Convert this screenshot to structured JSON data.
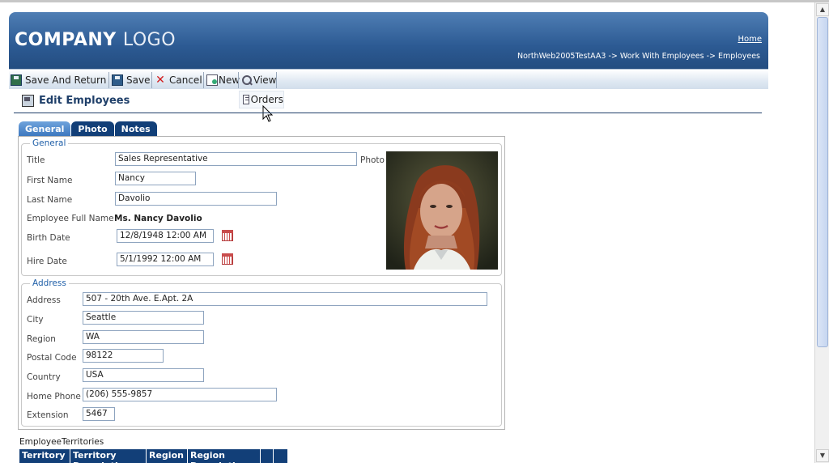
{
  "header": {
    "logo_bold": "COMPANY",
    "logo_light": "LOGO",
    "home_link": "Home",
    "breadcrumb": "NorthWeb2005TestAA3 -> Work With Employees -> Employees"
  },
  "toolbar": {
    "save_and_return": "Save And Return",
    "save": "Save",
    "cancel": "Cancel",
    "new": "New",
    "view": "View",
    "orders": "Orders"
  },
  "page": {
    "title": "Edit Employees"
  },
  "tabs": [
    "General",
    "Photo",
    "Notes"
  ],
  "general": {
    "legend": "General",
    "title_label": "Title",
    "title_value": "Sales Representative",
    "first_name_label": "First Name",
    "first_name_value": "Nancy",
    "last_name_label": "Last Name",
    "last_name_value": "Davolio",
    "full_name_label": "Employee Full Name",
    "full_name_value": "Ms. Nancy Davolio",
    "birth_date_label": "Birth Date",
    "birth_date_value": "12/8/1948 12:00 AM",
    "hire_date_label": "Hire Date",
    "hire_date_value": "5/1/1992 12:00 AM",
    "photo_label": "Photo"
  },
  "address": {
    "legend": "Address",
    "address_label": "Address",
    "address_value": "507 - 20th Ave. E.Apt. 2A",
    "city_label": "City",
    "city_value": "Seattle",
    "region_label": "Region",
    "region_value": "WA",
    "postal_label": "Postal Code",
    "postal_value": "98122",
    "country_label": "Country",
    "country_value": "USA",
    "home_phone_label": "Home Phone",
    "home_phone_value": "(206) 555-9857",
    "extension_label": "Extension",
    "extension_value": "5467"
  },
  "territories": {
    "label": "EmployeeTerritories",
    "columns": [
      "Territory",
      "Territory Description",
      "Region",
      "Region Description",
      "",
      ""
    ]
  }
}
